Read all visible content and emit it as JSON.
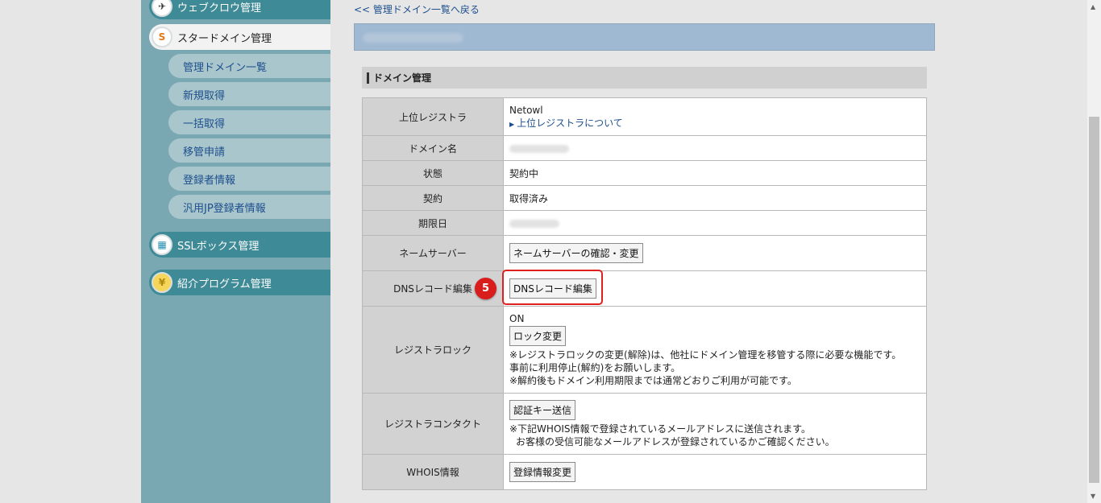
{
  "sidebar": {
    "top_items": [
      {
        "label": "ウェブクロウ管理",
        "icon": "crow-icon"
      },
      {
        "label": "スタードメイン管理",
        "icon": "star-domain-icon"
      },
      {
        "label": "SSLボックス管理",
        "icon": "ssl-box-icon"
      },
      {
        "label": "紹介プログラム管理",
        "icon": "yen-coin-icon"
      }
    ],
    "sub_items": [
      {
        "label": "管理ドメイン一覧"
      },
      {
        "label": "新規取得"
      },
      {
        "label": "一括取得"
      },
      {
        "label": "移管申請"
      },
      {
        "label": "登録者情報"
      },
      {
        "label": "汎用JP登録者情報"
      }
    ]
  },
  "main": {
    "back_link": "<< 管理ドメイン一覧へ戻る",
    "section_title": "ドメイン管理",
    "rows": {
      "registrar": {
        "label": "上位レジストラ",
        "value": "Netowl",
        "link": "上位レジストラについて"
      },
      "domain_name": {
        "label": "ドメイン名"
      },
      "status": {
        "label": "状態",
        "value": "契約中"
      },
      "contract": {
        "label": "契約",
        "value": "取得済み"
      },
      "expiry": {
        "label": "期限日"
      },
      "nameserver": {
        "label": "ネームサーバー",
        "button": "ネームサーバーの確認・変更"
      },
      "dns": {
        "label": "DNSレコード編集",
        "button": "DNSレコード編集"
      },
      "lock": {
        "label": "レジストラロック",
        "value": "ON",
        "button": "ロック変更",
        "note1": "※レジストラロックの変更(解除)は、他社にドメイン管理を移管する際に必要な機能です。事前に利用停止(解約)をお願いします。",
        "note2": "※解約後もドメイン利用期限までは通常どおりご利用が可能です。"
      },
      "contact": {
        "label": "レジストラコンタクト",
        "button": "認証キー送信",
        "note1": "※下記WHOIS情報で登録されているメールアドレスに送信されます。",
        "note2": "お客様の受信可能なメールアドレスが登録されているかご確認ください。"
      },
      "whois": {
        "label": "WHOIS情報",
        "button": "登録情報変更"
      }
    }
  },
  "annotation": {
    "step": "5",
    "color": "#e01f1f"
  }
}
